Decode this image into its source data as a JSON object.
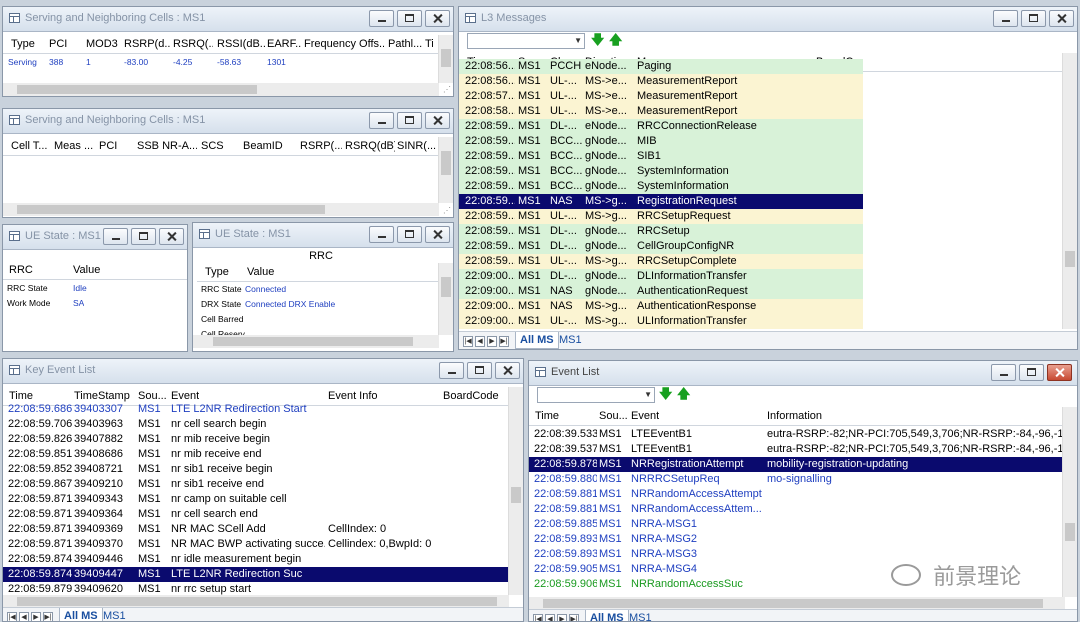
{
  "snc1": {
    "title": "Serving and Neighboring Cells : MS1",
    "headers": [
      "Type",
      "PCI",
      "MOD3",
      "RSRP(d...",
      "RSRQ(...",
      "RSSI(dB...",
      "EARF...",
      "Frequency Offs...",
      "Pathl...",
      "Ti"
    ],
    "row": [
      "Serving",
      "388",
      "1",
      "-83.00",
      "-4.25",
      "-58.63",
      "1301"
    ]
  },
  "snc2": {
    "title": "Serving and Neighboring Cells : MS1",
    "headers": [
      "Cell T...",
      "Meas ...",
      "PCI",
      "SSB NR-A...",
      "SCS",
      "BeamID",
      "RSRP(...",
      "RSRQ(dB)",
      "SINR(..."
    ]
  },
  "ue1": {
    "title": "UE State : MS1",
    "headers": [
      "RRC",
      "Value"
    ],
    "rows": [
      [
        "RRC State",
        "Idle"
      ],
      [
        "Work Mode",
        "SA"
      ]
    ]
  },
  "ue2": {
    "title": "UE State : MS1",
    "group": "RRC",
    "headers": [
      "Type",
      "Value"
    ],
    "rows": [
      [
        "RRC State",
        "Connected"
      ],
      [
        "DRX State",
        "Connected DRX Enable"
      ],
      [
        "Cell Barred",
        ""
      ],
      [
        "Cell Reserv...",
        ""
      ]
    ]
  },
  "l3": {
    "title": "L3 Messages",
    "headers": [
      "Time",
      "Sou...",
      "Cha...",
      "Direction",
      "Message",
      "BoardC..."
    ],
    "rows": [
      [
        "22:08:56...",
        "MS1",
        "PCCH",
        "eNode...",
        "Paging",
        "g"
      ],
      [
        "22:08:56...",
        "MS1",
        "UL-...",
        "MS->e...",
        "MeasurementReport",
        "y"
      ],
      [
        "22:08:57...",
        "MS1",
        "UL-...",
        "MS->e...",
        "MeasurementReport",
        "y"
      ],
      [
        "22:08:58...",
        "MS1",
        "UL-...",
        "MS->e...",
        "MeasurementReport",
        "y"
      ],
      [
        "22:08:59...",
        "MS1",
        "DL-...",
        "eNode...",
        "RRCConnectionRelease",
        "g"
      ],
      [
        "22:08:59...",
        "MS1",
        "BCC...",
        "gNode...",
        "MIB",
        "g"
      ],
      [
        "22:08:59...",
        "MS1",
        "BCC...",
        "gNode...",
        "SIB1",
        "g"
      ],
      [
        "22:08:59...",
        "MS1",
        "BCC...",
        "gNode...",
        "SystemInformation",
        "g"
      ],
      [
        "22:08:59...",
        "MS1",
        "BCC...",
        "gNode...",
        "SystemInformation",
        "g"
      ],
      [
        "22:08:59...",
        "MS1",
        "NAS",
        "MS->g...",
        "RegistrationRequest",
        "s"
      ],
      [
        "22:08:59...",
        "MS1",
        "UL-...",
        "MS->g...",
        "RRCSetupRequest",
        "y"
      ],
      [
        "22:08:59...",
        "MS1",
        "DL-...",
        "gNode...",
        "RRCSetup",
        "g"
      ],
      [
        "22:08:59...",
        "MS1",
        "DL-...",
        "gNode...",
        "CellGroupConfigNR",
        "g"
      ],
      [
        "22:08:59...",
        "MS1",
        "UL-...",
        "MS->g...",
        "RRCSetupComplete",
        "y"
      ],
      [
        "22:09:00...",
        "MS1",
        "DL-...",
        "gNode...",
        "DLInformationTransfer",
        "g"
      ],
      [
        "22:09:00...",
        "MS1",
        "NAS",
        "gNode...",
        "AuthenticationRequest",
        "g"
      ],
      [
        "22:09:00...",
        "MS1",
        "NAS",
        "MS->g...",
        "AuthenticationResponse",
        "y"
      ],
      [
        "22:09:00...",
        "MS1",
        "UL-...",
        "MS->g...",
        "ULInformationTransfer",
        "y"
      ]
    ],
    "tabs": [
      "All MS",
      "MS1"
    ]
  },
  "kel": {
    "title": "Key Event List",
    "headers": [
      "Time",
      "TimeStamp",
      "Sou...",
      "Event",
      "Event Info",
      "BoardCode"
    ],
    "rows": [
      [
        "22:08:59.686",
        "39403307",
        "MS1",
        "LTE L2NR Redirection Start",
        "",
        "b"
      ],
      [
        "22:08:59.706",
        "39403963",
        "MS1",
        "nr cell search begin",
        "",
        "k"
      ],
      [
        "22:08:59.826",
        "39407882",
        "MS1",
        "nr mib receive begin",
        "",
        "k"
      ],
      [
        "22:08:59.851",
        "39408686",
        "MS1",
        "nr mib receive end",
        "",
        "k"
      ],
      [
        "22:08:59.852",
        "39408721",
        "MS1",
        "nr sib1 receive begin",
        "",
        "k"
      ],
      [
        "22:08:59.867",
        "39409210",
        "MS1",
        "nr sib1 receive end",
        "",
        "k"
      ],
      [
        "22:08:59.871",
        "39409343",
        "MS1",
        "nr camp on suitable cell",
        "",
        "k"
      ],
      [
        "22:08:59.871",
        "39409364",
        "MS1",
        "nr cell search end",
        "",
        "k"
      ],
      [
        "22:08:59.871",
        "39409369",
        "MS1",
        "NR MAC SCell Add",
        "CellIndex: 0",
        "k"
      ],
      [
        "22:08:59.871",
        "39409370",
        "MS1",
        "NR MAC BWP activating succe...",
        "Cellindex: 0,BwpId: 0",
        "k"
      ],
      [
        "22:08:59.874",
        "39409446",
        "MS1",
        "nr idle measurement begin",
        "",
        "k"
      ],
      [
        "22:08:59.874",
        "39409447",
        "MS1",
        "LTE L2NR Redirection Suc",
        "",
        "s"
      ],
      [
        "22:08:59.879",
        "39409620",
        "MS1",
        "nr rrc setup start",
        "",
        "k"
      ]
    ],
    "tabs": [
      "All MS",
      "MS1"
    ]
  },
  "el": {
    "title": "Event List",
    "headers": [
      "Time",
      "Sou...",
      "Event",
      "Information"
    ],
    "rows": [
      [
        "22:08:39.533",
        "MS1",
        "LTEEventB1",
        "eutra-RSRP:-82;NR-PCI:705,549,3,706;NR-RSRP:-84,-96,-101,-...",
        "k"
      ],
      [
        "22:08:39.537",
        "MS1",
        "LTEEventB1",
        "eutra-RSRP:-82;NR-PCI:705,549,3,706;NR-RSRP:-84,-96,-101,-...",
        "k"
      ],
      [
        "22:08:59.878",
        "MS1",
        "NRRegistrationAttempt",
        "mobility-registration-updating",
        "s"
      ],
      [
        "22:08:59.880",
        "MS1",
        "NRRRCSetupReq",
        "mo-signalling",
        "b"
      ],
      [
        "22:08:59.881",
        "MS1",
        "NRRandomAccessAttempt",
        "",
        "b"
      ],
      [
        "22:08:59.881",
        "MS1",
        "NRRandomAccessAttem...",
        "",
        "b"
      ],
      [
        "22:08:59.885",
        "MS1",
        "NRRA-MSG1",
        "",
        "b"
      ],
      [
        "22:08:59.893",
        "MS1",
        "NRRA-MSG2",
        "",
        "b"
      ],
      [
        "22:08:59.893",
        "MS1",
        "NRRA-MSG3",
        "",
        "b"
      ],
      [
        "22:08:59.905",
        "MS1",
        "NRRA-MSG4",
        "",
        "b"
      ],
      [
        "22:08:59.906",
        "MS1",
        "NRRandomAccessSuc",
        "",
        "gr"
      ]
    ],
    "tabs": [
      "All MS",
      "MS1"
    ]
  },
  "watermark": "前景理论"
}
